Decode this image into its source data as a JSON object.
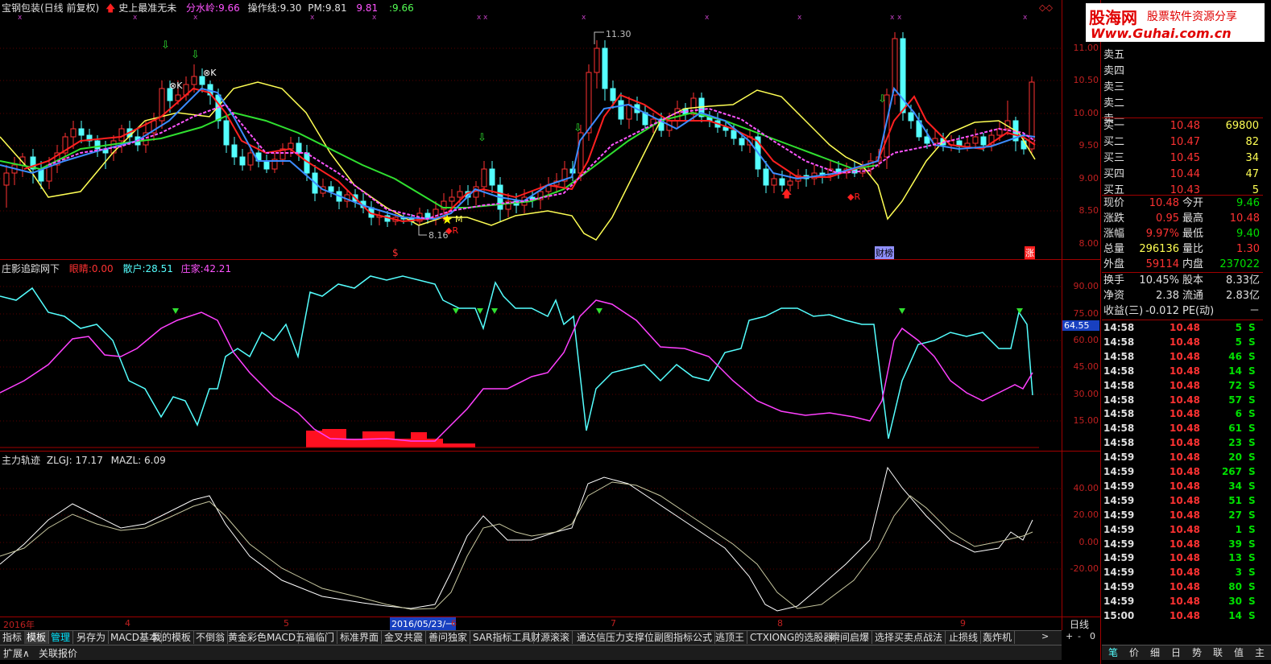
{
  "header": {
    "title": "宝钢包装(日线 前复权)",
    "indicator": "史上最准无未",
    "fenshui_label": "分水岭:",
    "fenshui_value": "9.66",
    "caozuo_label": "操作线:",
    "caozuo_value": "9.30",
    "pm_label": "PM:",
    "pm_value": "9.81",
    "v1": "9.81",
    "v2": "9.66"
  },
  "main_chart": {
    "price_ticks": [
      "11.00",
      "10.50",
      "10.00",
      "9.50",
      "9.00",
      "8.50",
      "8.00"
    ],
    "annotations": {
      "high": "11.30",
      "low": "8.16"
    },
    "markers": {
      "s": "$",
      "finance": "财榜",
      "zhang": "涨"
    }
  },
  "panel2": {
    "title": "庄影追踪网下",
    "kan_label": "眼睛:",
    "kan_value": "0.00",
    "sanhu_label": "散户:",
    "sanhu_value": "28.51",
    "zhuang_label": "庄家:",
    "zhuang_value": "42.21",
    "ticks": [
      "90.00",
      "75.00",
      "60.00",
      "45.00",
      "30.00",
      "15.00"
    ],
    "current_value": "64.55"
  },
  "panel3": {
    "title": "主力轨迹",
    "zlgj_label": "ZLGJ:",
    "zlgj_value": "17.17",
    "mazl_label": "MAZL:",
    "mazl_value": "6.09",
    "ticks": [
      "40.00",
      "20.00",
      "0.00",
      "-20.00"
    ]
  },
  "time_axis": {
    "labels": [
      "2016年",
      "4",
      "5",
      "2016/05/23/一",
      "6",
      "7",
      "8",
      "9"
    ],
    "period": "日线"
  },
  "tabs": [
    "指标",
    "模板",
    "管理",
    "另存为",
    "MACD基本",
    "我的模板",
    "不倒翁",
    "黄金彩色MACD",
    "五福临门",
    "标准界面",
    "金叉共震",
    "善问独家",
    "SAR指标工具",
    "财源滚滚",
    "通达信压力支撑位副图指标公式",
    "逃顶王",
    "CTXIONG的选股器",
    "瞬间启爆",
    "选择买卖点战法",
    "止损线",
    "轰炸机"
  ],
  "bottom_row": {
    "expand": "扩展∧",
    "related": "关联报价"
  },
  "nav_buttons": {
    "next": ">",
    "plus": "+",
    "minus": "-",
    "zero": "0"
  },
  "watermark": {
    "logo": "股海网",
    "slogan": "股票软件资源分享",
    "url": "Www.Guhai.com.cn"
  },
  "quotes": {
    "sell": [
      {
        "label": "卖五",
        "price": "",
        "vol": ""
      },
      {
        "label": "卖四",
        "price": "",
        "vol": ""
      },
      {
        "label": "卖三",
        "price": "",
        "vol": ""
      },
      {
        "label": "卖二",
        "price": "",
        "vol": ""
      },
      {
        "label": "卖一",
        "price": "",
        "vol": ""
      }
    ],
    "buy": [
      {
        "label": "买一",
        "price": "10.48",
        "vol": "69800"
      },
      {
        "label": "买二",
        "price": "10.47",
        "vol": "82"
      },
      {
        "label": "买三",
        "price": "10.45",
        "vol": "34"
      },
      {
        "label": "买四",
        "price": "10.44",
        "vol": "47"
      },
      {
        "label": "买五",
        "price": "10.43",
        "vol": "5"
      }
    ],
    "stats": [
      {
        "l1": "现价",
        "v1": "10.48",
        "l2": "今开",
        "v2": "9.46"
      },
      {
        "l1": "涨跌",
        "v1": "0.95",
        "l2": "最高",
        "v2": "10.48"
      },
      {
        "l1": "涨幅",
        "v1": "9.97%",
        "l2": "最低",
        "v2": "9.40"
      },
      {
        "l1": "总量",
        "v1": "296136",
        "l2": "量比",
        "v2": "1.30"
      },
      {
        "l1": "外盘",
        "v1": "59114",
        "l2": "内盘",
        "v2": "237022"
      }
    ],
    "info": [
      {
        "l1": "换手",
        "v1": "10.45%",
        "l2": "股本",
        "v2": "8.33亿"
      },
      {
        "l1": "净资",
        "v1": "2.38",
        "l2": "流通",
        "v2": "2.83亿"
      },
      {
        "l1": "收益(三)",
        "v1": "-0.012",
        "l2": "PE(动)",
        "v2": "－"
      }
    ]
  },
  "ticks_list": [
    {
      "t": "14:58",
      "p": "10.48",
      "v": "5",
      "s": "S"
    },
    {
      "t": "14:58",
      "p": "10.48",
      "v": "5",
      "s": "S"
    },
    {
      "t": "14:58",
      "p": "10.48",
      "v": "46",
      "s": "S"
    },
    {
      "t": "14:58",
      "p": "10.48",
      "v": "14",
      "s": "S"
    },
    {
      "t": "14:58",
      "p": "10.48",
      "v": "72",
      "s": "S"
    },
    {
      "t": "14:58",
      "p": "10.48",
      "v": "57",
      "s": "S"
    },
    {
      "t": "14:58",
      "p": "10.48",
      "v": "6",
      "s": "S"
    },
    {
      "t": "14:58",
      "p": "10.48",
      "v": "61",
      "s": "S"
    },
    {
      "t": "14:58",
      "p": "10.48",
      "v": "23",
      "s": "S"
    },
    {
      "t": "14:59",
      "p": "10.48",
      "v": "20",
      "s": "S"
    },
    {
      "t": "14:59",
      "p": "10.48",
      "v": "267",
      "s": "S"
    },
    {
      "t": "14:59",
      "p": "10.48",
      "v": "34",
      "s": "S"
    },
    {
      "t": "14:59",
      "p": "10.48",
      "v": "51",
      "s": "S"
    },
    {
      "t": "14:59",
      "p": "10.48",
      "v": "27",
      "s": "S"
    },
    {
      "t": "14:59",
      "p": "10.48",
      "v": "1",
      "s": "S"
    },
    {
      "t": "14:59",
      "p": "10.48",
      "v": "39",
      "s": "S"
    },
    {
      "t": "14:59",
      "p": "10.48",
      "v": "13",
      "s": "S"
    },
    {
      "t": "14:59",
      "p": "10.48",
      "v": "3",
      "s": "S"
    },
    {
      "t": "14:59",
      "p": "10.48",
      "v": "80",
      "s": "S"
    },
    {
      "t": "14:59",
      "p": "10.48",
      "v": "30",
      "s": "S"
    },
    {
      "t": "15:00",
      "p": "10.48",
      "v": "14",
      "s": "S"
    }
  ],
  "right_tabs": [
    "笔",
    "价",
    "细",
    "日",
    "势",
    "联",
    "值",
    "主"
  ],
  "colors": {
    "up": "#ff3232",
    "down": "#54ffff",
    "ma_yellow": "#ffff54",
    "ma_green": "#00e000",
    "ma_blue": "#3c8cff",
    "ma_red": "#ff2020",
    "mag": "#ff54ff"
  }
}
